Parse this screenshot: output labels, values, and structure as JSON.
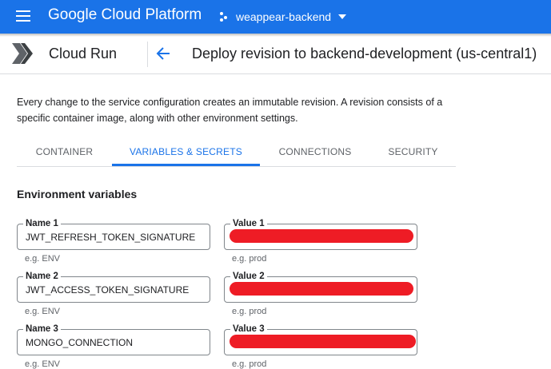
{
  "header": {
    "brand": "Google Cloud Platform",
    "project_name": "weappear-backend",
    "icons": [
      "hamburger-menu-icon",
      "project-dots-icon",
      "dropdown-caret-icon"
    ]
  },
  "subheader": {
    "product_name": "Cloud Run",
    "page_title": "Deploy revision to backend-development (us-central1)",
    "icons": [
      "cloud-run-logo-icon",
      "back-arrow-icon"
    ]
  },
  "description": "Every change to the service configuration creates an immutable revision. A revision consists of a specific container image, along with other environment settings.",
  "tabs": [
    {
      "label": "CONTAINER",
      "active": false
    },
    {
      "label": "VARIABLES & SECRETS",
      "active": true
    },
    {
      "label": "CONNECTIONS",
      "active": false
    },
    {
      "label": "SECURITY",
      "active": false
    }
  ],
  "section_title": "Environment variables",
  "env_vars": [
    {
      "name_label": "Name 1",
      "name_value": "JWT_REFRESH_TOKEN_SIGNATURE",
      "name_hint": "e.g. ENV",
      "value_label": "Value 1",
      "value_hint": "e.g. prod"
    },
    {
      "name_label": "Name 2",
      "name_value": "JWT_ACCESS_TOKEN_SIGNATURE",
      "name_hint": "e.g. ENV",
      "value_label": "Value 2",
      "value_hint": "e.g. prod"
    },
    {
      "name_label": "Name 3",
      "name_value": "MONGO_CONNECTION",
      "name_hint": "e.g. ENV",
      "value_label": "Value 3",
      "value_hint": "e.g. prod"
    }
  ],
  "colors": {
    "brand_blue": "#1a73e8",
    "redaction": "#ee1c25",
    "border": "#80868b",
    "muted_text": "#5f6368"
  }
}
